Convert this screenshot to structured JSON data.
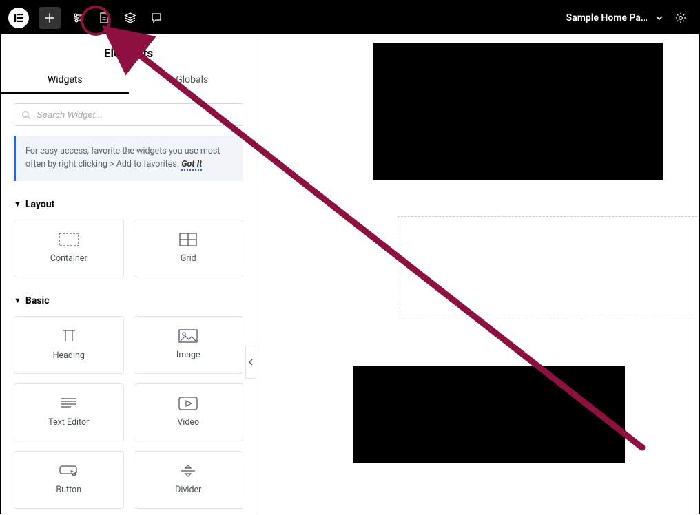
{
  "topbar": {
    "page_title": "Sample Home Pa…"
  },
  "sidebar": {
    "title": "Elements",
    "tabs": {
      "widgets": "Widgets",
      "globals": "Globals"
    },
    "search_placeholder": "Search Widget...",
    "tip_text": "For easy access, favorite the widgets you use most often by right clicking > Add to favorites. ",
    "tip_action": "Got It",
    "sections": {
      "layout": {
        "title": "Layout",
        "items": {
          "container": "Container",
          "grid": "Grid"
        }
      },
      "basic": {
        "title": "Basic",
        "items": {
          "heading": "Heading",
          "image": "Image",
          "text_editor": "Text Editor",
          "video": "Video",
          "button": "Button",
          "divider": "Divider"
        }
      }
    }
  }
}
